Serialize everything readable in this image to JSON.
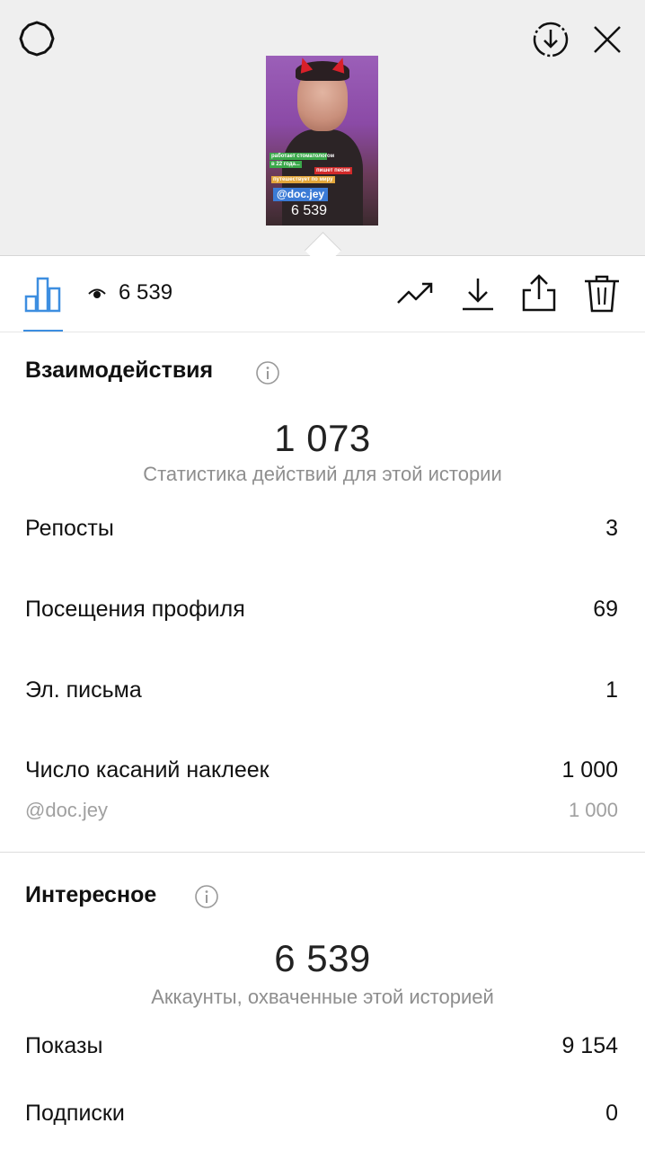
{
  "header": {
    "settings_icon": "settings-gear-icon",
    "download_icon": "download-circle-icon",
    "close_icon": "close-icon",
    "story_thumbnail": {
      "stickers": [
        "работает стоматологом",
        "в 22 года...",
        "пишет песни",
        "путешествует по миру",
        "@doc.jey",
        "6 539"
      ]
    }
  },
  "toolbar": {
    "insights_icon": "bar-chart-icon",
    "views_icon": "eye-icon",
    "views_count": "6 539",
    "actions": [
      "trending-up-icon",
      "download-icon",
      "share-icon",
      "trash-icon"
    ],
    "accent_color": "#3d8ee0"
  },
  "interactions": {
    "title": "Взаимодействия",
    "total": "1 073",
    "subtitle": "Статистика действий для этой истории",
    "rows": [
      {
        "label": "Репосты",
        "value": "3"
      },
      {
        "label": "Посещения профиля",
        "value": "69"
      },
      {
        "label": "Эл. письма",
        "value": "1"
      },
      {
        "label": "Число касаний наклеек",
        "value": "1 000"
      }
    ],
    "sticker_detail": {
      "label": "@doc.jey",
      "value": "1 000"
    }
  },
  "discovery": {
    "title": "Интересное",
    "total": "6 539",
    "subtitle": "Аккаунты, охваченные этой историей",
    "rows": [
      {
        "label": "Показы",
        "value": "9 154"
      },
      {
        "label": "Подписки",
        "value": "0"
      }
    ]
  }
}
